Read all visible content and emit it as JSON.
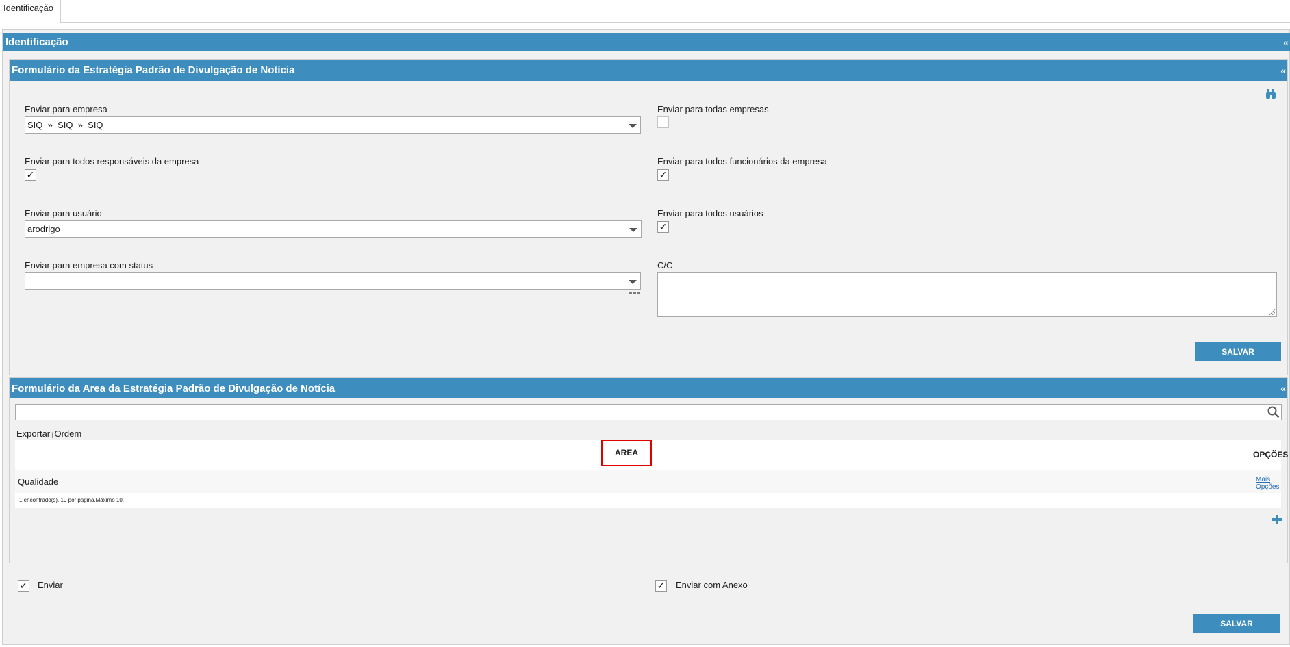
{
  "tab": {
    "label": "Identificação"
  },
  "section": {
    "title": "Identificação",
    "collapse": "«"
  },
  "form1": {
    "title": "Formulário da Estratégia Padrão de Divulgação de Notícia",
    "collapse": "«",
    "empresa_label": "Enviar para empresa",
    "empresa_value": "SIQ  »  SIQ  »  SIQ",
    "todas_empresas_label": "Enviar para todas empresas",
    "todos_responsaveis_label": "Enviar para todos responsáveis da empresa",
    "todos_funcionarios_label": "Enviar para todos funcionários da empresa",
    "usuario_label": "Enviar para usuário",
    "usuario_value": "arodrigo",
    "todos_usuarios_label": "Enviar para todos usuários",
    "status_label": "Enviar para empresa com status",
    "status_value": "",
    "cc_label": "C/C",
    "cc_value": "",
    "save_label": "SALVAR",
    "check_mark": "✓"
  },
  "form2": {
    "title": "Formulário da Area da Estratégia Padrão de Divulgação de Notícia",
    "collapse": "«",
    "search_value": "",
    "export_label": "Exportar",
    "order_label": "Ordem",
    "columns": [
      "AREA",
      "OPÇÕES"
    ],
    "rows": [
      {
        "area": "Qualidade",
        "more_line1": "Mais",
        "more_line2": "Opções"
      }
    ],
    "footer_found": "1 encontrado(s). ",
    "footer_per_page": "10",
    "footer_mid": " por página.Máximo ",
    "footer_max": "10",
    "footer_end": "."
  },
  "bottom": {
    "enviar_label": "Enviar",
    "anexo_label": "Enviar com Anexo",
    "save_label": "SALVAR"
  },
  "colors": {
    "accent": "#3d8ebf",
    "highlight": "#e00000"
  },
  "icons": [
    "binoculars-icon",
    "dropdown-arrow-icon",
    "ellipsis-icon",
    "search-icon",
    "plus-icon",
    "checkmark-icon"
  ]
}
